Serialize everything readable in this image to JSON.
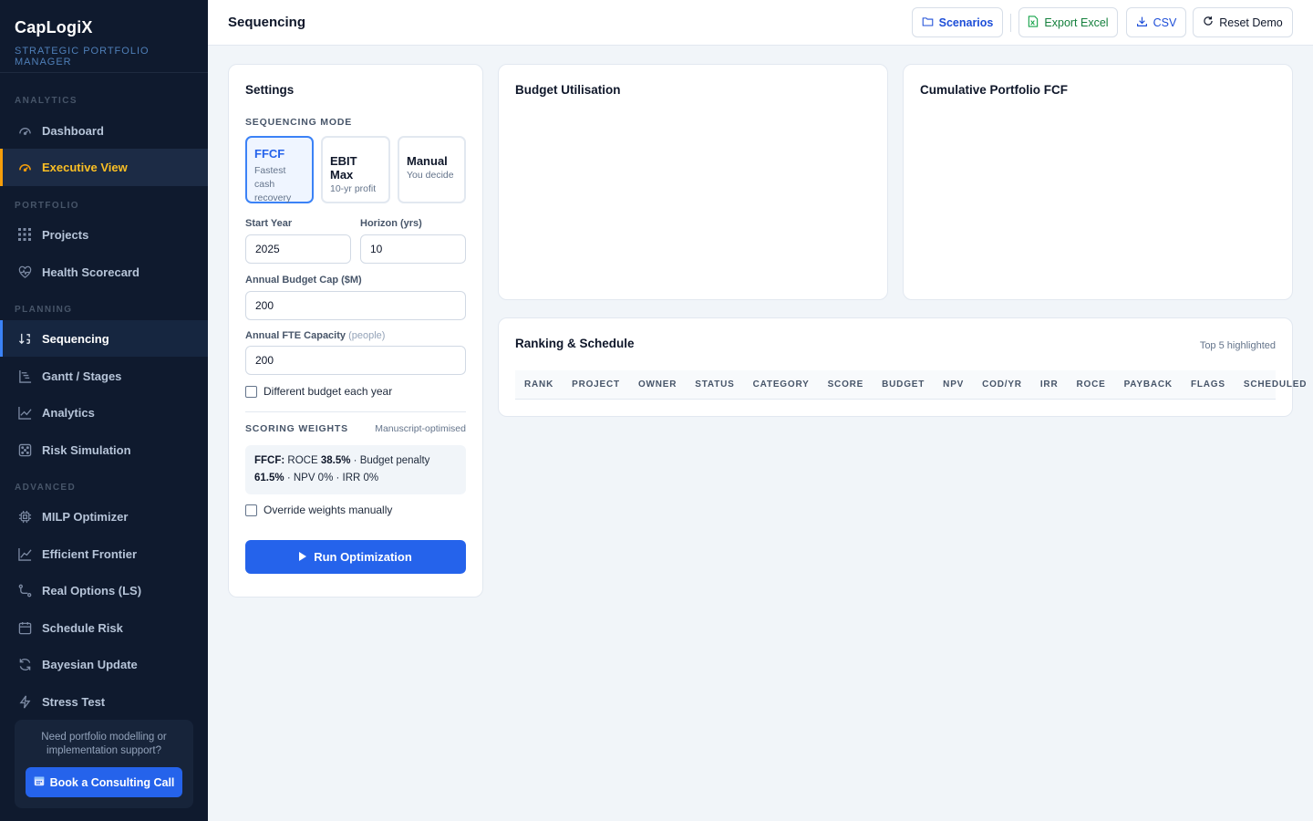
{
  "brand": {
    "name": "CapLogiX",
    "subtitle": "STRATEGIC PORTFOLIO MANAGER"
  },
  "sidebar": {
    "sections": [
      {
        "label": "ANALYTICS",
        "items": [
          {
            "label": "Dashboard",
            "icon": "gauge-icon"
          },
          {
            "label": "Executive View",
            "icon": "speedometer-icon",
            "state": "highlighted"
          }
        ]
      },
      {
        "label": "PORTFOLIO",
        "items": [
          {
            "label": "Projects",
            "icon": "grid-icon"
          },
          {
            "label": "Health Scorecard",
            "icon": "heart-pulse-icon"
          }
        ]
      },
      {
        "label": "PLANNING",
        "items": [
          {
            "label": "Sequencing",
            "icon": "sort-icon",
            "state": "active"
          },
          {
            "label": "Gantt / Stages",
            "icon": "gantt-icon"
          },
          {
            "label": "Analytics",
            "icon": "line-chart-icon"
          },
          {
            "label": "Risk Simulation",
            "icon": "dice-icon"
          }
        ]
      },
      {
        "label": "ADVANCED",
        "items": [
          {
            "label": "MILP Optimizer",
            "icon": "chip-icon"
          },
          {
            "label": "Efficient Frontier",
            "icon": "trend-icon"
          },
          {
            "label": "Real Options (LS)",
            "icon": "route-icon"
          },
          {
            "label": "Schedule Risk",
            "icon": "calendar-icon"
          },
          {
            "label": "Bayesian Update",
            "icon": "refresh-icon"
          },
          {
            "label": "Stress Test",
            "icon": "bolt-icon"
          }
        ]
      }
    ],
    "consult": {
      "text": "Need portfolio modelling or implementation support?",
      "button": "Book a Consulting Call"
    }
  },
  "topbar": {
    "title": "Sequencing",
    "buttons": {
      "scenarios": "Scenarios",
      "export_excel": "Export Excel",
      "csv": "CSV",
      "reset": "Reset Demo"
    }
  },
  "settings": {
    "title": "Settings",
    "mode_label": "SEQUENCING MODE",
    "modes": [
      {
        "name": "FFCF",
        "desc": "Fastest cash recovery",
        "selected": true
      },
      {
        "name": "EBIT Max",
        "desc": "10-yr profit",
        "selected": false
      },
      {
        "name": "Manual",
        "desc": "You decide",
        "selected": false
      }
    ],
    "start_year": {
      "label": "Start Year",
      "value": "2025"
    },
    "horizon": {
      "label": "Horizon (yrs)",
      "value": "10"
    },
    "budget_cap": {
      "label": "Annual Budget Cap ($M)",
      "value": "200"
    },
    "fte": {
      "label": "Annual FTE Capacity",
      "unit": "(people)",
      "value": "200"
    },
    "different_budget": "Different budget each year",
    "weights_label": "SCORING WEIGHTS",
    "weights_tag": "Manuscript-optimised",
    "weights": {
      "mode": "FFCF:",
      "roce_label": "ROCE",
      "roce": "38.5%",
      "budget_label": "· Budget penalty",
      "budget": "61.5%",
      "rest": "· NPV 0% · IRR 0%"
    },
    "override": "Override weights manually",
    "run": "Run Optimization"
  },
  "budget_card": {
    "title": "Budget Utilisation"
  },
  "fcf_card": {
    "title": "Cumulative Portfolio FCF"
  },
  "ranking": {
    "title": "Ranking & Schedule",
    "hint": "Top 5 highlighted",
    "columns": [
      "RANK",
      "PROJECT",
      "OWNER",
      "STATUS",
      "CATEGORY",
      "SCORE",
      "BUDGET",
      "NPV",
      "COD/YR",
      "IRR",
      "ROCE",
      "PAYBACK",
      "FLAGS",
      "SCHEDULED"
    ]
  }
}
